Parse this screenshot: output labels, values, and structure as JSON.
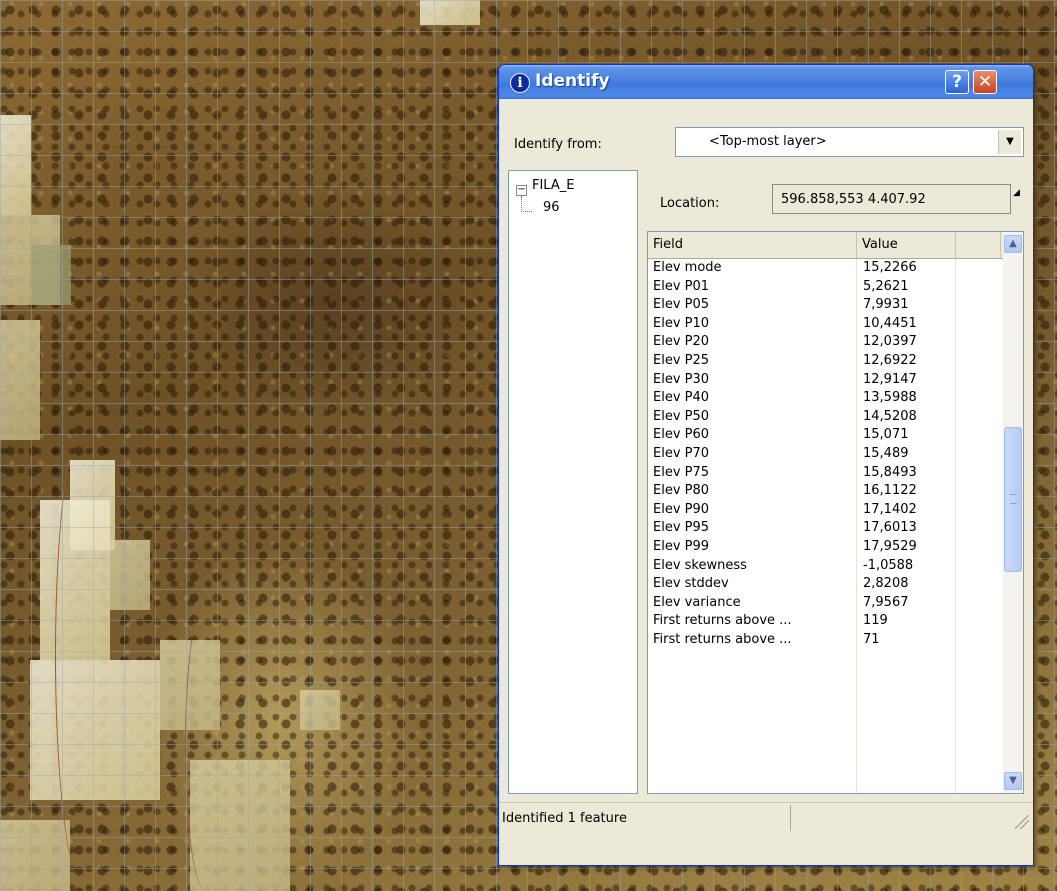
{
  "window": {
    "title": "Identify",
    "help_glyph": "?",
    "close_glyph": "✕",
    "info_glyph": "i"
  },
  "identify_from": {
    "label": "Identify from:",
    "selected": "<Top-most layer>"
  },
  "tree": {
    "toggle": "−",
    "layer": "FILA_E",
    "feature": "96"
  },
  "location": {
    "label": "Location:",
    "value": "596.858,553  4.407.92"
  },
  "table": {
    "headers": [
      "Field",
      "Value"
    ],
    "rows": [
      {
        "field": "Elev mode",
        "value": "15,2266"
      },
      {
        "field": "Elev P01",
        "value": "5,2621"
      },
      {
        "field": "Elev P05",
        "value": "7,9931"
      },
      {
        "field": "Elev P10",
        "value": "10,4451"
      },
      {
        "field": "Elev P20",
        "value": "12,0397"
      },
      {
        "field": "Elev P25",
        "value": "12,6922"
      },
      {
        "field": "Elev P30",
        "value": "12,9147"
      },
      {
        "field": "Elev P40",
        "value": "13,5988"
      },
      {
        "field": "Elev P50",
        "value": "14,5208"
      },
      {
        "field": "Elev P60",
        "value": "15,071"
      },
      {
        "field": "Elev P70",
        "value": "15,489"
      },
      {
        "field": "Elev P75",
        "value": "15,8493"
      },
      {
        "field": "Elev P80",
        "value": "16,1122"
      },
      {
        "field": "Elev P90",
        "value": "17,1402"
      },
      {
        "field": "Elev P95",
        "value": "17,6013"
      },
      {
        "field": "Elev P99",
        "value": "17,9529"
      },
      {
        "field": "Elev skewness",
        "value": "-1,0588"
      },
      {
        "field": "Elev stddev",
        "value": "2,8208"
      },
      {
        "field": "Elev variance",
        "value": "7,9567"
      },
      {
        "field": "First returns above ...",
        "value": "119"
      },
      {
        "field": "First returns above ...",
        "value": "71"
      }
    ]
  },
  "status": {
    "text": "Identified 1 feature"
  },
  "colors": {
    "titlebar": "#3f78dc",
    "window_bg": "#ece9d8",
    "close_button": "#c84422"
  }
}
